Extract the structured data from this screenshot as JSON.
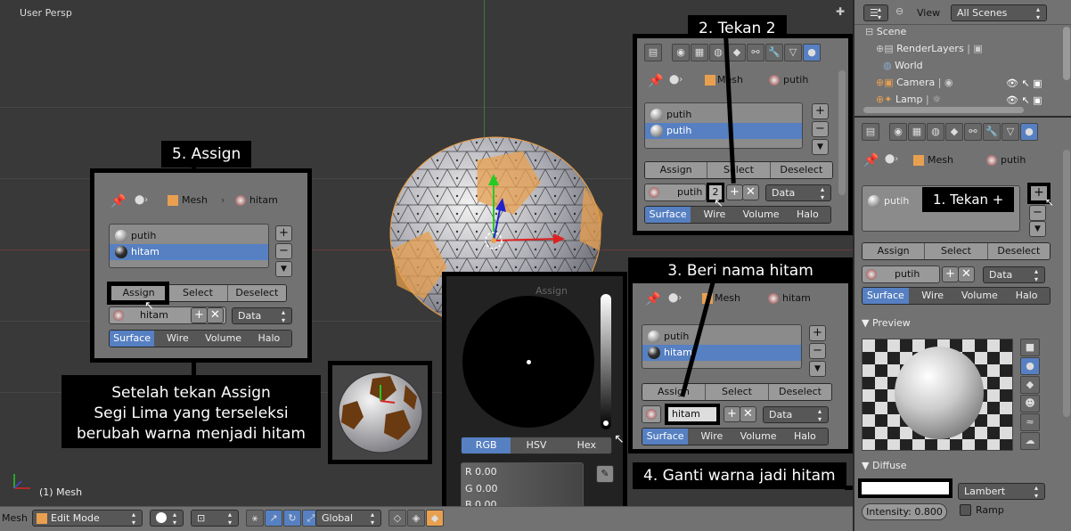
{
  "viewport": {
    "title": "User Persp",
    "object_label": "(1) Mesh"
  },
  "header": {
    "mesh_label": "Mesh",
    "mode": "Edit Mode",
    "orientation": "Global"
  },
  "outliner": {
    "view": "View",
    "scenes": "All Scenes",
    "items": [
      "Scene",
      "RenderLayers",
      "World",
      "Camera",
      "Lamp"
    ]
  },
  "props": {
    "mesh": "Mesh",
    "material": "putih",
    "slots": [
      "putih"
    ],
    "assign": "Assign",
    "select": "Select",
    "deselect": "Deselect",
    "mat_name": "putih",
    "link": "Data",
    "tabs": [
      "Surface",
      "Wire",
      "Volume",
      "Halo"
    ],
    "preview": "Preview",
    "diffuse": "Diffuse",
    "shader": "Lambert",
    "intensity": "Intensity: 0.800",
    "ramp": "Ramp"
  },
  "step1": {
    "callout": "1. Tekan +"
  },
  "step2": {
    "callout": "2. Tekan 2",
    "mesh": "Mesh",
    "material": "putih",
    "slots": [
      "putih",
      "putih"
    ],
    "assign": "Assign",
    "select": "Select",
    "deselect": "Deselect",
    "mat_name": "putih",
    "users": "2",
    "link": "Data",
    "tabs": [
      "Surface",
      "Wire",
      "Volume",
      "Halo"
    ]
  },
  "step3": {
    "callout": "3. Beri nama hitam",
    "mesh": "Mesh",
    "material": "hitam",
    "slots": [
      "putih",
      "hitam"
    ],
    "assign": "Assign",
    "select": "Select",
    "deselect": "Deselect",
    "mat_name": "hitam",
    "link": "Data",
    "tabs": [
      "Surface",
      "Wire",
      "Volume",
      "Halo"
    ]
  },
  "step4": {
    "callout": "4. Ganti warna jadi hitam",
    "modes": [
      "RGB",
      "HSV",
      "Hex"
    ],
    "r": "R 0.00",
    "g": "G 0.00",
    "b": "B 0.00",
    "hidden_assign": "Assign"
  },
  "step5": {
    "callout": "5. Assign",
    "mesh": "Mesh",
    "material": "hitam",
    "slots": [
      "putih",
      "hitam"
    ],
    "assign": "Assign",
    "select": "Select",
    "deselect": "Deselect",
    "mat_name": "hitam",
    "link": "Data",
    "tabs": [
      "Surface",
      "Wire",
      "Volume",
      "Halo"
    ]
  },
  "note": {
    "lines": [
      "Setelah tekan Assign",
      "Segi Lima yang terseleksi",
      "berubah warna menjadi hitam"
    ]
  },
  "colors": {
    "accent": "#5680c2",
    "orange": "#e8a050",
    "panel": "#727272",
    "bg": "#393939"
  }
}
